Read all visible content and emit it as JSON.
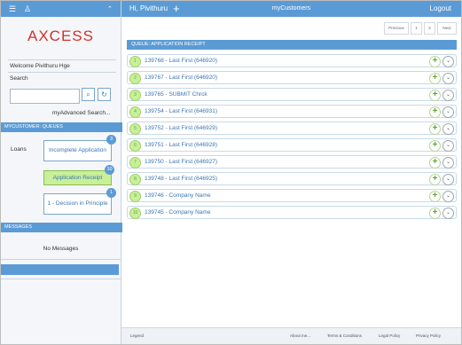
{
  "sidebar": {
    "icons": [
      "menu-icon",
      "user-icon",
      "chevron-up-icon"
    ],
    "brand": "AXCESS",
    "welcome": "Welcome Pivithuru Hge",
    "search_label": "Search",
    "search_placeholder": "",
    "advanced_search": "myAdvanced Search...",
    "queues_header": "MYCUSTOMER: QUEUES",
    "loans_label": "Loans",
    "queues": [
      {
        "label": "Incomplete Application",
        "count": "3"
      },
      {
        "label": "Application Receipt",
        "count": "10"
      },
      {
        "label": "1 - Decision in Principle",
        "count": "1"
      }
    ],
    "messages_header": "MESSAGES",
    "no_messages": "No Messages"
  },
  "header": {
    "greeting": "Hi, Pivithuru",
    "add_symbol": "+",
    "title": "myCustomers",
    "logout": "Logout"
  },
  "pagination": {
    "previous": "Previous",
    "pages": [
      "1",
      "2"
    ],
    "next": "Next"
  },
  "queue": {
    "header": "QUEUE: APPLICATION RECEIPT",
    "items": [
      {
        "num": "1",
        "label": "139768 - Last First (646920)"
      },
      {
        "num": "2",
        "label": "139767 - Last First (646920)"
      },
      {
        "num": "3",
        "label": "139765 - SUBMIT Chrck"
      },
      {
        "num": "4",
        "label": "139754 - Last First (646931)"
      },
      {
        "num": "5",
        "label": "139752 - Last First (646929)"
      },
      {
        "num": "6",
        "label": "139751 - Last First (646928)"
      },
      {
        "num": "7",
        "label": "139750 - Last First (646927)"
      },
      {
        "num": "8",
        "label": "139748 - Last First (646925)"
      },
      {
        "num": "9",
        "label": "139746 - Company Name"
      },
      {
        "num": "10",
        "label": "139745 - Company Name"
      }
    ]
  },
  "footer": {
    "legend": "Legend",
    "links": [
      "About me...",
      "Terms & Conditions",
      "Legal Policy",
      "Privacy Policy"
    ]
  },
  "colors": {
    "accent": "#5b9bd5",
    "brand_red": "#d0342c",
    "active_queue": "#c9ef9b",
    "link_blue": "#3a76b3"
  }
}
